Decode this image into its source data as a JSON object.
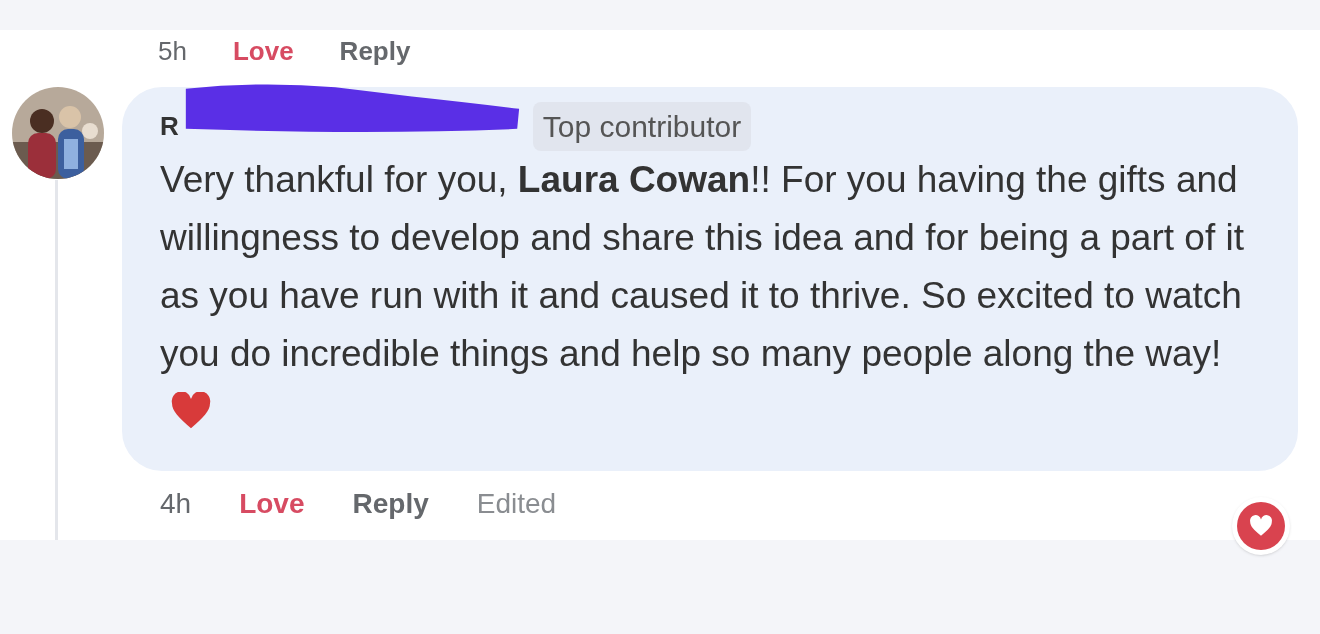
{
  "previous_comment_actions": {
    "time": "5h",
    "love": "Love",
    "reply": "Reply"
  },
  "comment": {
    "author": "R",
    "badge": "Top contributor",
    "text": "Very thankful for you, **Laura Cowan**!! For you having the gifts and willingness to develop and share this idea and for being a part of it as you have run with it and caused it to thrive. So excited to watch you do incredible things and help so many people along the way!",
    "loved": true,
    "time": "4h",
    "love": "Love",
    "reply": "Reply",
    "edited": "Edited"
  }
}
